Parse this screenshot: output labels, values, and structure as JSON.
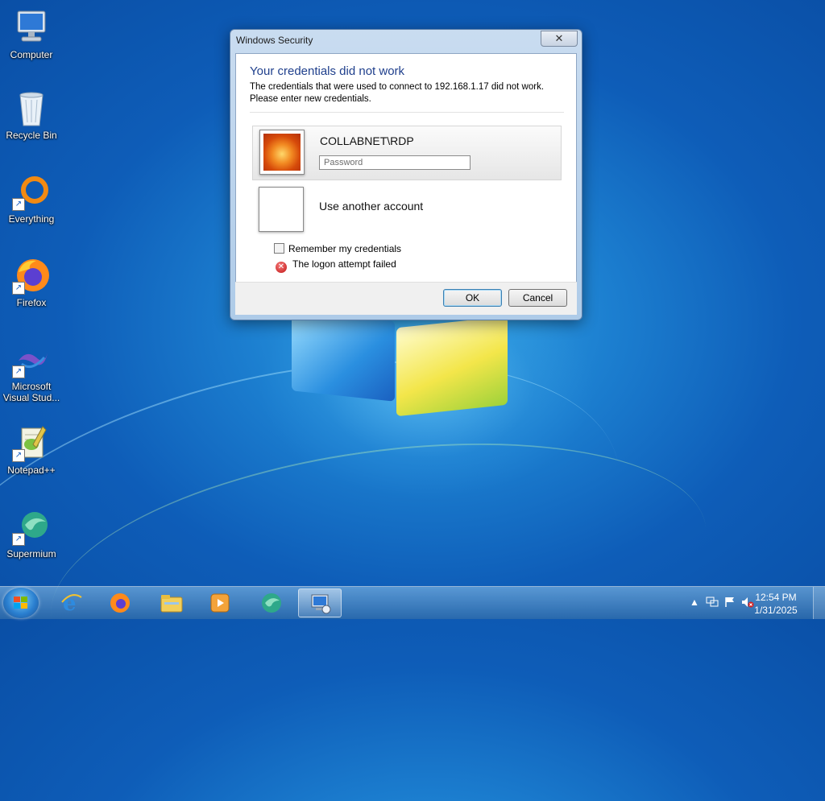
{
  "desktop": {
    "icons": [
      {
        "label": "Computer",
        "icon": "computer-icon"
      },
      {
        "label": "Recycle Bin",
        "icon": "recycle-bin-icon"
      },
      {
        "label": "Everything",
        "icon": "everything-icon"
      },
      {
        "label": "Firefox",
        "icon": "firefox-icon"
      },
      {
        "label": "Microsoft Visual Stud...",
        "icon": "visual-studio-icon"
      },
      {
        "label": "Notepad++",
        "icon": "notepad-plus-plus-icon"
      },
      {
        "label": "Supermium",
        "icon": "supermium-icon"
      }
    ]
  },
  "dialog": {
    "window_title": "Windows Security",
    "close_glyph": "✕",
    "heading": "Your credentials did not work",
    "description_line1": "The credentials that were used to connect to 192.168.1.17 did not work.",
    "description_line2": "Please enter new credentials.",
    "selected_account": "COLLABNET\\RDP",
    "password_placeholder": "Password",
    "other_account": "Use another account",
    "remember_label": "Remember my credentials",
    "error_text": "The logon attempt failed",
    "error_glyph": "✕",
    "ok_label": "OK",
    "cancel_label": "Cancel"
  },
  "taskbar": {
    "pinned": [
      "internet-explorer-icon",
      "firefox-icon",
      "file-explorer-icon",
      "media-player-icon",
      "supermium-icon",
      "remote-desktop-icon"
    ],
    "tray_arrow": "▲",
    "clock_time": "12:54 PM",
    "clock_date": "1/31/2025"
  },
  "colors": {
    "heading": "#1f3f8c",
    "wallpaper": "#1c7fd0",
    "error": "#c21414"
  }
}
